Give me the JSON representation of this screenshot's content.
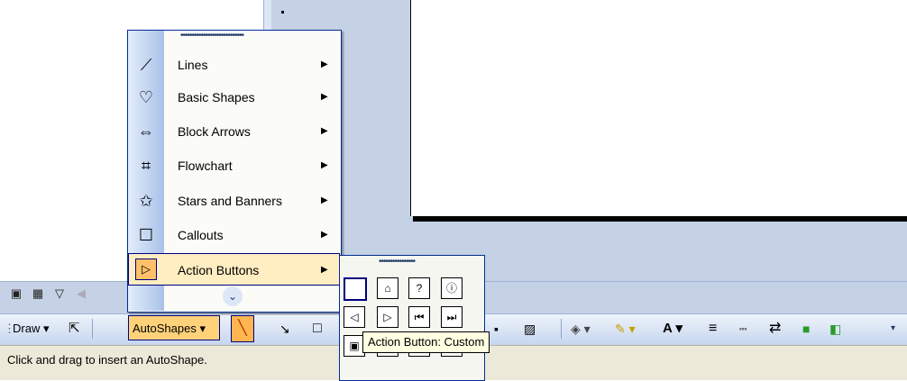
{
  "colors": {
    "menu_highlight": "#ffeec2",
    "menu_border": "#002d96",
    "toolbar": "#c6d6ee",
    "statusbar": "#ece9d8"
  },
  "autoshapes_menu": {
    "items": [
      {
        "label": "Lines",
        "icon": "lines-icon",
        "glyph": "⟋"
      },
      {
        "label": "Basic Shapes",
        "icon": "basic-shapes-icon",
        "glyph": "♡"
      },
      {
        "label": "Block Arrows",
        "icon": "block-arrows-icon",
        "glyph": "⇔"
      },
      {
        "label": "Flowchart",
        "icon": "flowchart-icon",
        "glyph": "⌗"
      },
      {
        "label": "Stars and Banners",
        "icon": "stars-banners-icon",
        "glyph": "✩"
      },
      {
        "label": "Callouts",
        "icon": "callouts-icon",
        "glyph": "☐"
      },
      {
        "label": "Action Buttons",
        "icon": "action-buttons-icon",
        "glyph": "▷"
      }
    ],
    "expand_icon": "chevron-down-icon"
  },
  "action_buttons": {
    "tooltip": "Action Button: Custom",
    "rows": [
      [
        "",
        "⌂",
        "?",
        "ⓘ"
      ],
      [
        "◁",
        "▷",
        "⏮",
        "⏭"
      ],
      [
        "▣",
        "▤",
        "◀",
        "▶"
      ]
    ]
  },
  "toolbar": {
    "draw_label": "Draw",
    "autoshapes_label": "AutoShapes"
  },
  "status": {
    "text": "Click and drag to insert an AutoShape."
  }
}
